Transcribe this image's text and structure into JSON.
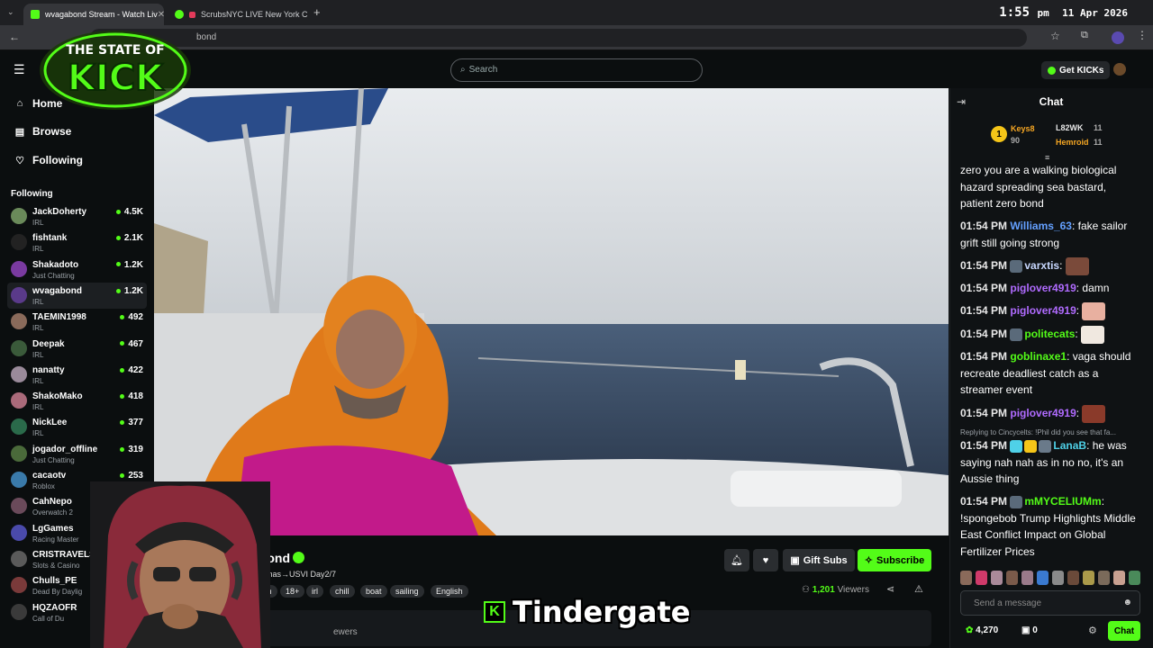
{
  "browser": {
    "tabs": [
      {
        "title": "wvagabond Stream - Watch Liv",
        "active": true
      },
      {
        "title": "ScrubsNYC LIVE New York C",
        "active": false
      }
    ],
    "url": "bond",
    "clock": {
      "time": "1:55",
      "ampm": "pm",
      "date": "11 Apr 2026"
    }
  },
  "overlay": {
    "logo_line1": "THE STATE OF",
    "logo_line2": "KICK",
    "caption": "Tindergate",
    "caption_k": "K"
  },
  "header": {
    "search_placeholder": "Search",
    "get_kicks": "Get KICKs"
  },
  "sidebar": {
    "nav": [
      {
        "label": "Home",
        "icon": "home-icon"
      },
      {
        "label": "Browse",
        "icon": "browse-icon"
      },
      {
        "label": "Following",
        "icon": "heart-icon"
      }
    ],
    "following_heading": "Following",
    "following": [
      {
        "name": "JackDoherty",
        "category": "IRL",
        "viewers": "4.5K",
        "color": "#6a8a5a"
      },
      {
        "name": "fishtank",
        "category": "IRL",
        "viewers": "2.1K",
        "color": "#222222"
      },
      {
        "name": "Shakadoto",
        "category": "Just Chatting",
        "viewers": "1.2K",
        "color": "#7a3aa0"
      },
      {
        "name": "wvagabond",
        "category": "IRL",
        "viewers": "1.2K",
        "color": "#5a3a8a"
      },
      {
        "name": "TAEMIN1998",
        "category": "IRL",
        "viewers": "492",
        "color": "#8a6a5a"
      },
      {
        "name": "Deepak",
        "category": "IRL",
        "viewers": "467",
        "color": "#3a5a3a"
      },
      {
        "name": "nanatty",
        "category": "IRL",
        "viewers": "422",
        "color": "#9a8a9a"
      },
      {
        "name": "ShakoMako",
        "category": "IRL",
        "viewers": "418",
        "color": "#aa6a7a"
      },
      {
        "name": "NickLee",
        "category": "IRL",
        "viewers": "377",
        "color": "#2a6a4a"
      },
      {
        "name": "jogador_offline",
        "category": "Just Chatting",
        "viewers": "319",
        "color": "#4a6a3a"
      },
      {
        "name": "cacaotv",
        "category": "Roblox",
        "viewers": "253",
        "color": "#3a7aaa"
      },
      {
        "name": "CahNepo",
        "category": "Overwatch 2",
        "viewers": "20",
        "color": "#6a4a5a"
      },
      {
        "name": "LgGames",
        "category": "Racing Master",
        "viewers": "",
        "color": "#4a4aaa"
      },
      {
        "name": "CRISTRAVELS",
        "category": "Slots & Casino",
        "viewers": "",
        "color": "#5a5a5a"
      },
      {
        "name": "Chulls_PE",
        "category": "Dead By Daylig",
        "viewers": "",
        "color": "#7a3a3a"
      },
      {
        "name": "HQZAOFR",
        "category": "Call of Du",
        "viewers": "",
        "color": "#3a3a3a"
      }
    ]
  },
  "stream": {
    "channel": "abond",
    "title": "ahamas→USVI Day2/7",
    "tags": [
      "nglish",
      "18+",
      "irl",
      "chill",
      "boat",
      "sailing",
      "English"
    ],
    "viewers_count": "1,201",
    "viewers_label": "Viewers",
    "gift_subs": "Gift Subs",
    "subscribe": "Subscribe",
    "about_viewers": "ewers"
  },
  "chat": {
    "title": "Chat",
    "leaderboard": [
      {
        "name": "Keys8",
        "score": "90",
        "color": "#f5a623"
      },
      {
        "name": "L82WK",
        "score": "11",
        "color": "#e8e8e8"
      },
      {
        "name": "Hemroid",
        "score": "11",
        "color": "#f5a623"
      }
    ],
    "rank_label": "1",
    "messages": [
      {
        "time": "",
        "user": "",
        "color": "#ffffff",
        "text": "zero you are a walking biological hazard spreading sea bastard, patient zero bond"
      },
      {
        "time": "01:54 PM",
        "user": "Williams_63",
        "color": "#64a0ff",
        "text": "fake sailor grift still going strong"
      },
      {
        "time": "01:54 PM",
        "user": "varxtis",
        "color": "#c8d8ff",
        "text": ""
      },
      {
        "time": "01:54 PM",
        "user": "piglover4919",
        "color": "#b06bff",
        "text": "damn"
      },
      {
        "time": "01:54 PM",
        "user": "piglover4919",
        "color": "#b06bff",
        "text": ""
      },
      {
        "time": "01:54 PM",
        "user": "politecats",
        "color": "#53fc18",
        "text": ""
      },
      {
        "time": "01:54 PM",
        "user": "goblinaxe1",
        "color": "#53fc18",
        "text": "vaga should recreate deadliest catch as a streamer event"
      },
      {
        "time": "01:54 PM",
        "user": "piglover4919",
        "color": "#b06bff",
        "text": ""
      },
      {
        "time": "01:54 PM",
        "user": "LanaB",
        "color": "#4fd1e8",
        "text": "he was saying nah nah as in no no, it's an Aussie thing"
      },
      {
        "time": "01:54 PM",
        "user": "mMYCELIUMm",
        "color": "#53fc18",
        "text": "!spongebob Trump Highlights Middle East Conflict Impact on Global Fertilizer Prices"
      }
    ],
    "reply_preview": "Replying to Cincycelts: !Phil did you see that fa...",
    "send_placeholder": "Send a message",
    "kicks_count": "4,270",
    "zero_count": "0",
    "chat_button": "Chat"
  }
}
